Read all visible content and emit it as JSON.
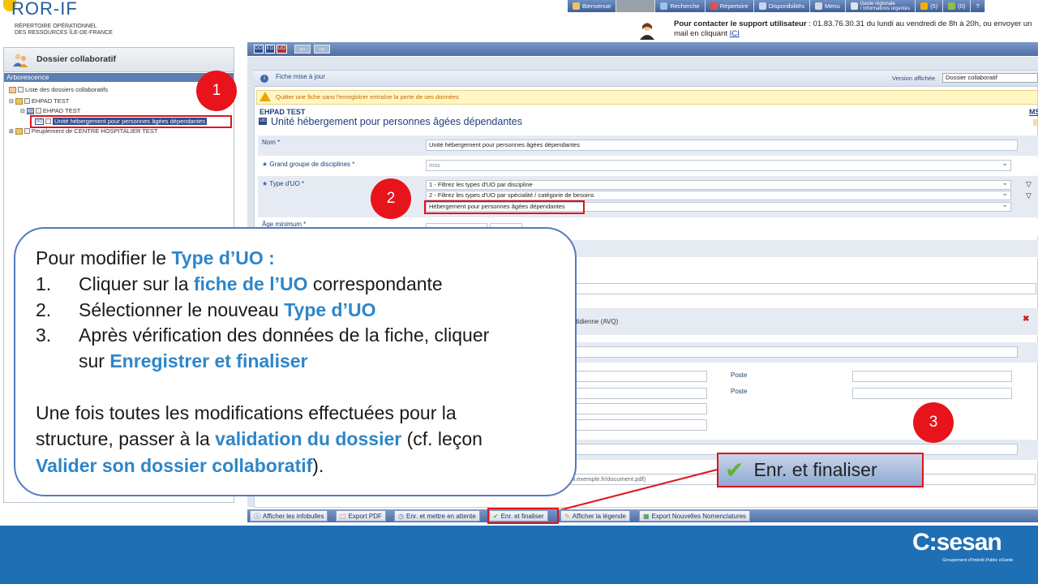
{
  "header": {
    "logo": "ROR-IF",
    "logo_sub1": "RÉPERTOIRE OPÉRATIONNEL",
    "logo_sub2": "DES RESSOURCES ÎLE-DE-FRANCE",
    "nav": {
      "bienvenue": "Bienvenue",
      "recherche": "Recherche",
      "repertoire": "Répertoire",
      "disponibilites": "Disponibilités",
      "menu": "Menu",
      "garde1": "Garde régionale",
      "garde2": "/ Informations urgentes",
      "alerts": "(5)",
      "messages": "(0)",
      "help": "?"
    },
    "support_bold": "Pour contacter le support utilisateur",
    "support_text": " : 01.83.76.30.31 du lundi au vendredi de 8h à 20h, ou envoyer un",
    "support_line2": "mail en cliquant ",
    "support_link": "ICI"
  },
  "left": {
    "title": "Dossier collaboratif",
    "arbo": "Arborescence",
    "tree": [
      "Liste des dossiers collaboratifs",
      "EHPAD TEST",
      "EHPAD TEST",
      "Unité hébergement pour personnes âgées dépendantes",
      "Peuplement de CENTRE HOSPITALIER TEST"
    ],
    "badge_uo": "UO",
    "badge_eg": "EG"
  },
  "toolbar": {
    "do": "DO",
    "eg": "EG",
    "uo": "UO"
  },
  "content": {
    "info_text": "Fiche mise à jour",
    "version_label": "Version affichée",
    "version_value": "Dossier collaboratif",
    "warning": "Quitter une fiche sans l'enregistrer entraîne la perte de ses données",
    "ehpad": "EHPAD TEST",
    "ms": "MS",
    "uo_badge": "UO",
    "uo_title": "Unité hébergement pour personnes âgées dépendantes",
    "nom_label": "Nom *",
    "nom_value": "Unité hébergement pour personnes âgées dépendantes",
    "ggd_label": "Grand groupe de disciplines *",
    "ggd_value": "mss",
    "type_label": "Type d'UO *",
    "type_opt1": "1 - Filtrez les types d'UO par discipline",
    "type_opt2": "2 - Filtrez les types d'UO par spécialité / catégorie de besoins",
    "type_opt3": "Hébergement pour personnes âgées dépendantes",
    "age_label": "Âge minimum *",
    "avq_text": "otidienne (AVQ)",
    "poste1": "Poste",
    "poste2": "Poste",
    "url_placeholder": "w.exemple.fr/document.pdf)"
  },
  "callout": {
    "intro": "Pour modifier le ",
    "intro_hl": "Type d’UO :",
    "n1": "1.",
    "s1a": "Cliquer sur la ",
    "s1hl": "fiche de l’UO",
    "s1b": " correspondante",
    "n2": "2.",
    "s2a": "Sélectionner le nouveau ",
    "s2hl": "Type d’UO",
    "n3": "3.",
    "s3a": "Après vérification des données de la fiche, cliquer",
    "s3b": "sur ",
    "s3hl": "Enregistrer et finaliser",
    "p2a": "Une fois toutes les modifications effectuées pour la",
    "p2b": "structure, passer à la ",
    "p2hl": "validation du dossier",
    "p2c": " (cf. leçon",
    "p2hl2": "Valider son dossier collaboratif",
    "p2d": ")."
  },
  "markers": {
    "m1": "1",
    "m2": "2",
    "m3": "3"
  },
  "big_button": "Enr. et finaliser",
  "bottom": {
    "infobulles": "Afficher les infobulles",
    "export_pdf": "Export PDF",
    "enr_attente": "Enr. et mettre en attente",
    "enr_finaliser": "Enr. et finaliser",
    "legende": "Afficher la légende",
    "export_nomen": "Export Nouvelles Nomenclatures"
  },
  "footer": {
    "brand": "C:sesan",
    "sub": "Groupement d'Intérêt Public eSanté"
  },
  "colors": {
    "accent": "#2e86c8",
    "annotation": "#e0141e",
    "footer": "#1f6fb5"
  }
}
